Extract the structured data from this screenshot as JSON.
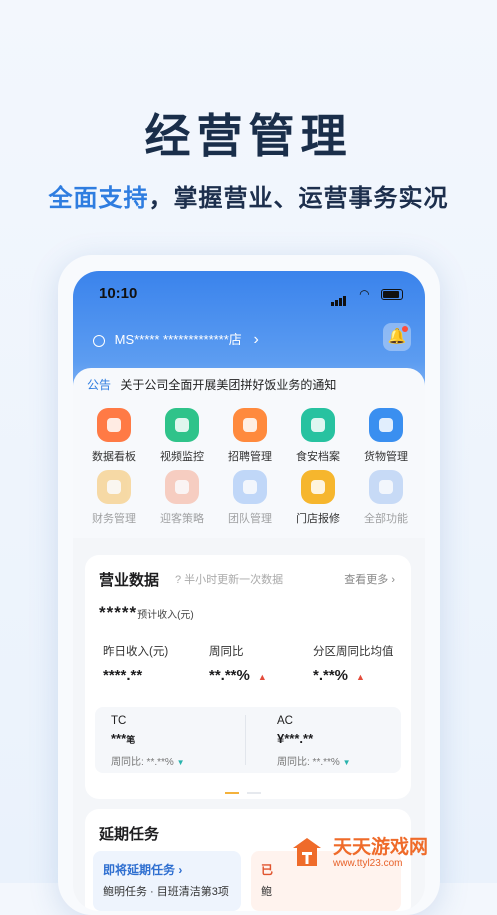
{
  "hero": {
    "title": "经营管理",
    "sub_a": "全面支持",
    "sub_b": "，掌握营业、运营事务实况"
  },
  "status": {
    "time": "10:10"
  },
  "store": {
    "name": "MS*****  *************店",
    "chevron": "›"
  },
  "notice": {
    "tag": "公告",
    "text": "关于公司全面开展美团拼好饭业务的通知"
  },
  "grid": [
    {
      "label": "数据看板",
      "color": "#ff7a45"
    },
    {
      "label": "视频监控",
      "color": "#2fc38a"
    },
    {
      "label": "招聘管理",
      "color": "#ff8a3d"
    },
    {
      "label": "食安档案",
      "color": "#27c2a0"
    },
    {
      "label": "货物管理",
      "color": "#3a8ff0"
    },
    {
      "label": "财务管理",
      "color": "#f6b43d"
    },
    {
      "label": "迎客策略",
      "color": "#f59a7a"
    },
    {
      "label": "团队管理",
      "color": "#7eb0f5"
    },
    {
      "label": "门店报修",
      "color": "#f6b62d"
    },
    {
      "label": "全部功能",
      "color": "#8fb5f0"
    }
  ],
  "business": {
    "title": "营业数据",
    "hint": "? 半小时更新一次数据",
    "more": "查看更多 ›",
    "estimate_value": "*****",
    "estimate_label": "预计收入(元)",
    "metrics": [
      {
        "label": "昨日收入(元)",
        "value": "****.**",
        "trend": ""
      },
      {
        "label": "周同比",
        "value": "**.**%",
        "trend": "▲"
      },
      {
        "label": "分区周同比均值",
        "value": "*.**%",
        "trend": "▲"
      }
    ],
    "tc": {
      "label": "TC",
      "value": "***",
      "unit": "笔",
      "compare": "周同比: **.**%",
      "trend": "▼"
    },
    "ac": {
      "label": "AC",
      "value": "¥***.**",
      "compare": "周同比: **.**%",
      "trend": "▼"
    }
  },
  "tasks": {
    "title": "延期任务",
    "item1_title": "即将延期任务",
    "item1_icon": "›",
    "item1_desc": "drawing",
    "item1_text": "鲍明任务 · 目班清洁第3项",
    "item2_title": "已",
    "item2_text": "鲍"
  },
  "watermark": {
    "name": "天天游戏网",
    "url": "www.ttyl23.com"
  }
}
